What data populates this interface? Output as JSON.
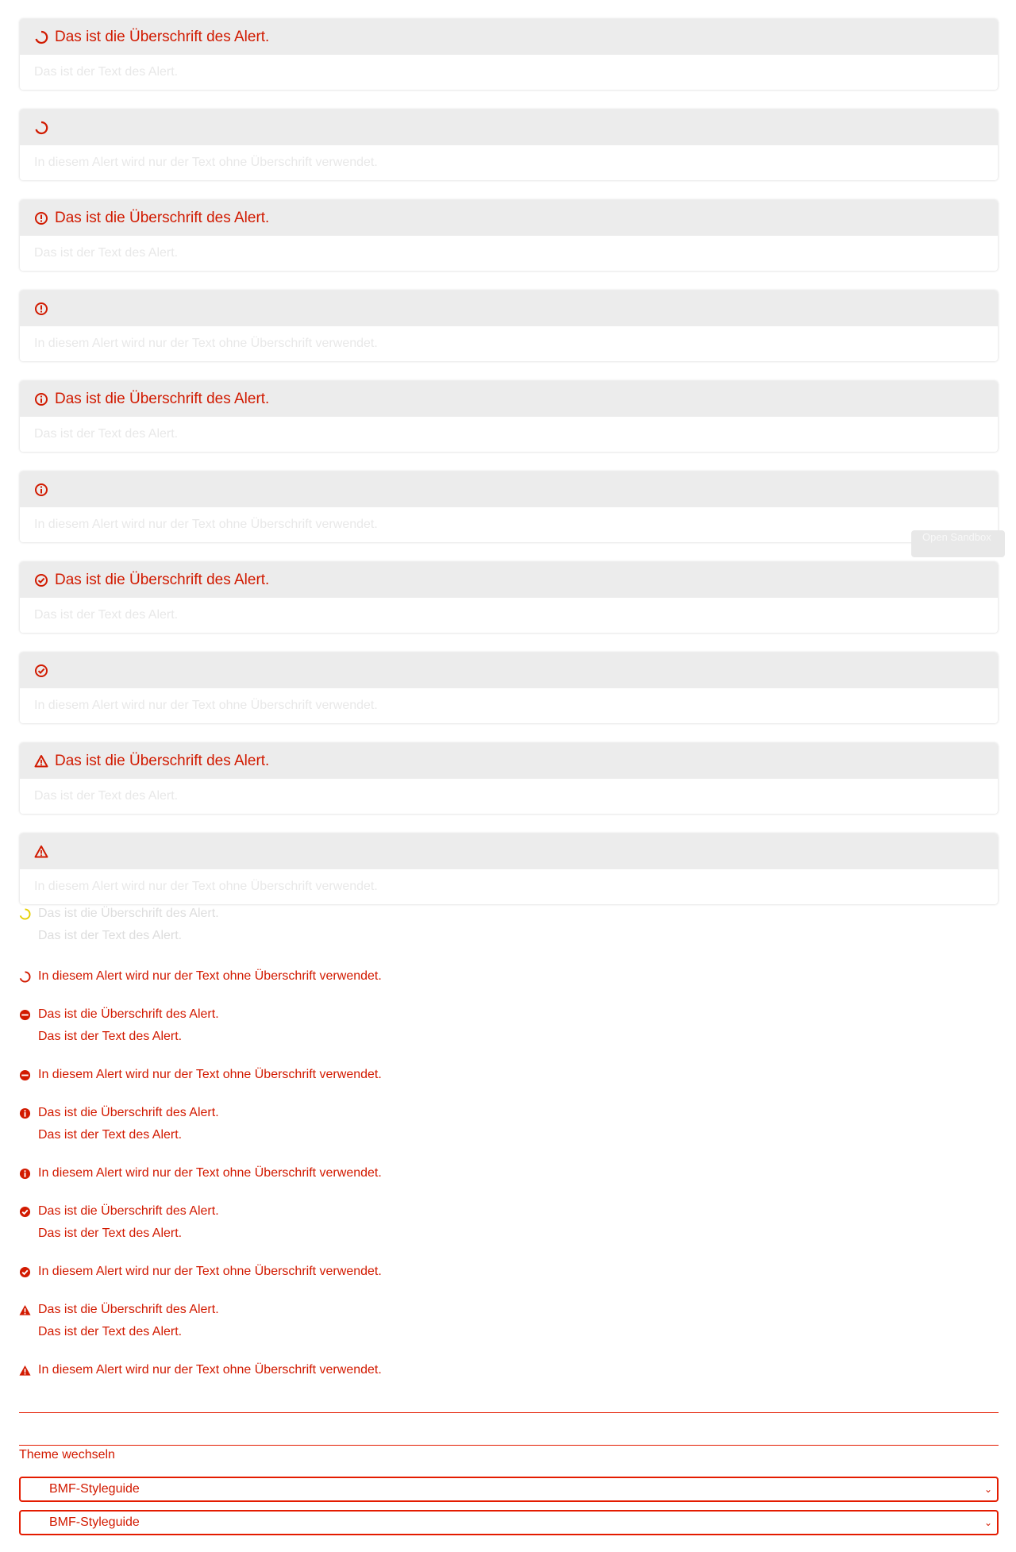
{
  "boxed_alerts": [
    {
      "icon": "loading-icon",
      "title": "Das ist die Überschrift des Alert.",
      "text": "Das ist der Text des Alert."
    },
    {
      "icon": "loading-icon",
      "title": "",
      "text": "In diesem Alert wird nur der Text ohne Überschrift verwendet."
    },
    {
      "icon": "error-icon",
      "title": "Das ist die Überschrift des Alert.",
      "text": "Das ist der Text des Alert."
    },
    {
      "icon": "error-icon",
      "title": "",
      "text": "In diesem Alert wird nur der Text ohne Überschrift verwendet."
    },
    {
      "icon": "info-icon",
      "title": "Das ist die Überschrift des Alert.",
      "text": "Das ist der Text des Alert."
    },
    {
      "icon": "info-icon",
      "title": "",
      "text": "In diesem Alert wird nur der Text ohne Überschrift verwendet."
    },
    {
      "icon": "success-icon",
      "title": "Das ist die Überschrift des Alert.",
      "text": "Das ist der Text des Alert."
    },
    {
      "icon": "success-icon",
      "title": "",
      "text": "In diesem Alert wird nur der Text ohne Überschrift verwendet."
    },
    {
      "icon": "warning-icon",
      "title": "Das ist die Überschrift des Alert.",
      "text": "Das ist der Text des Alert."
    },
    {
      "icon": "warning-icon",
      "title": "",
      "text": "In diesem Alert wird nur der Text ohne Überschrift verwendet."
    }
  ],
  "inline_alerts": {
    "heading": "Das ist die Überschrift des Alert.",
    "text": "Das ist der Text des Alert.",
    "text_only": "In diesem Alert wird nur der Text ohne Überschrift verwendet."
  },
  "sandbox": {
    "label": "Open Sandbox"
  },
  "theme": {
    "label": "Theme wechseln",
    "selected": "BMF-Styleguide"
  },
  "colors": {
    "accent": "#e41b00",
    "panel": "#ececec"
  }
}
